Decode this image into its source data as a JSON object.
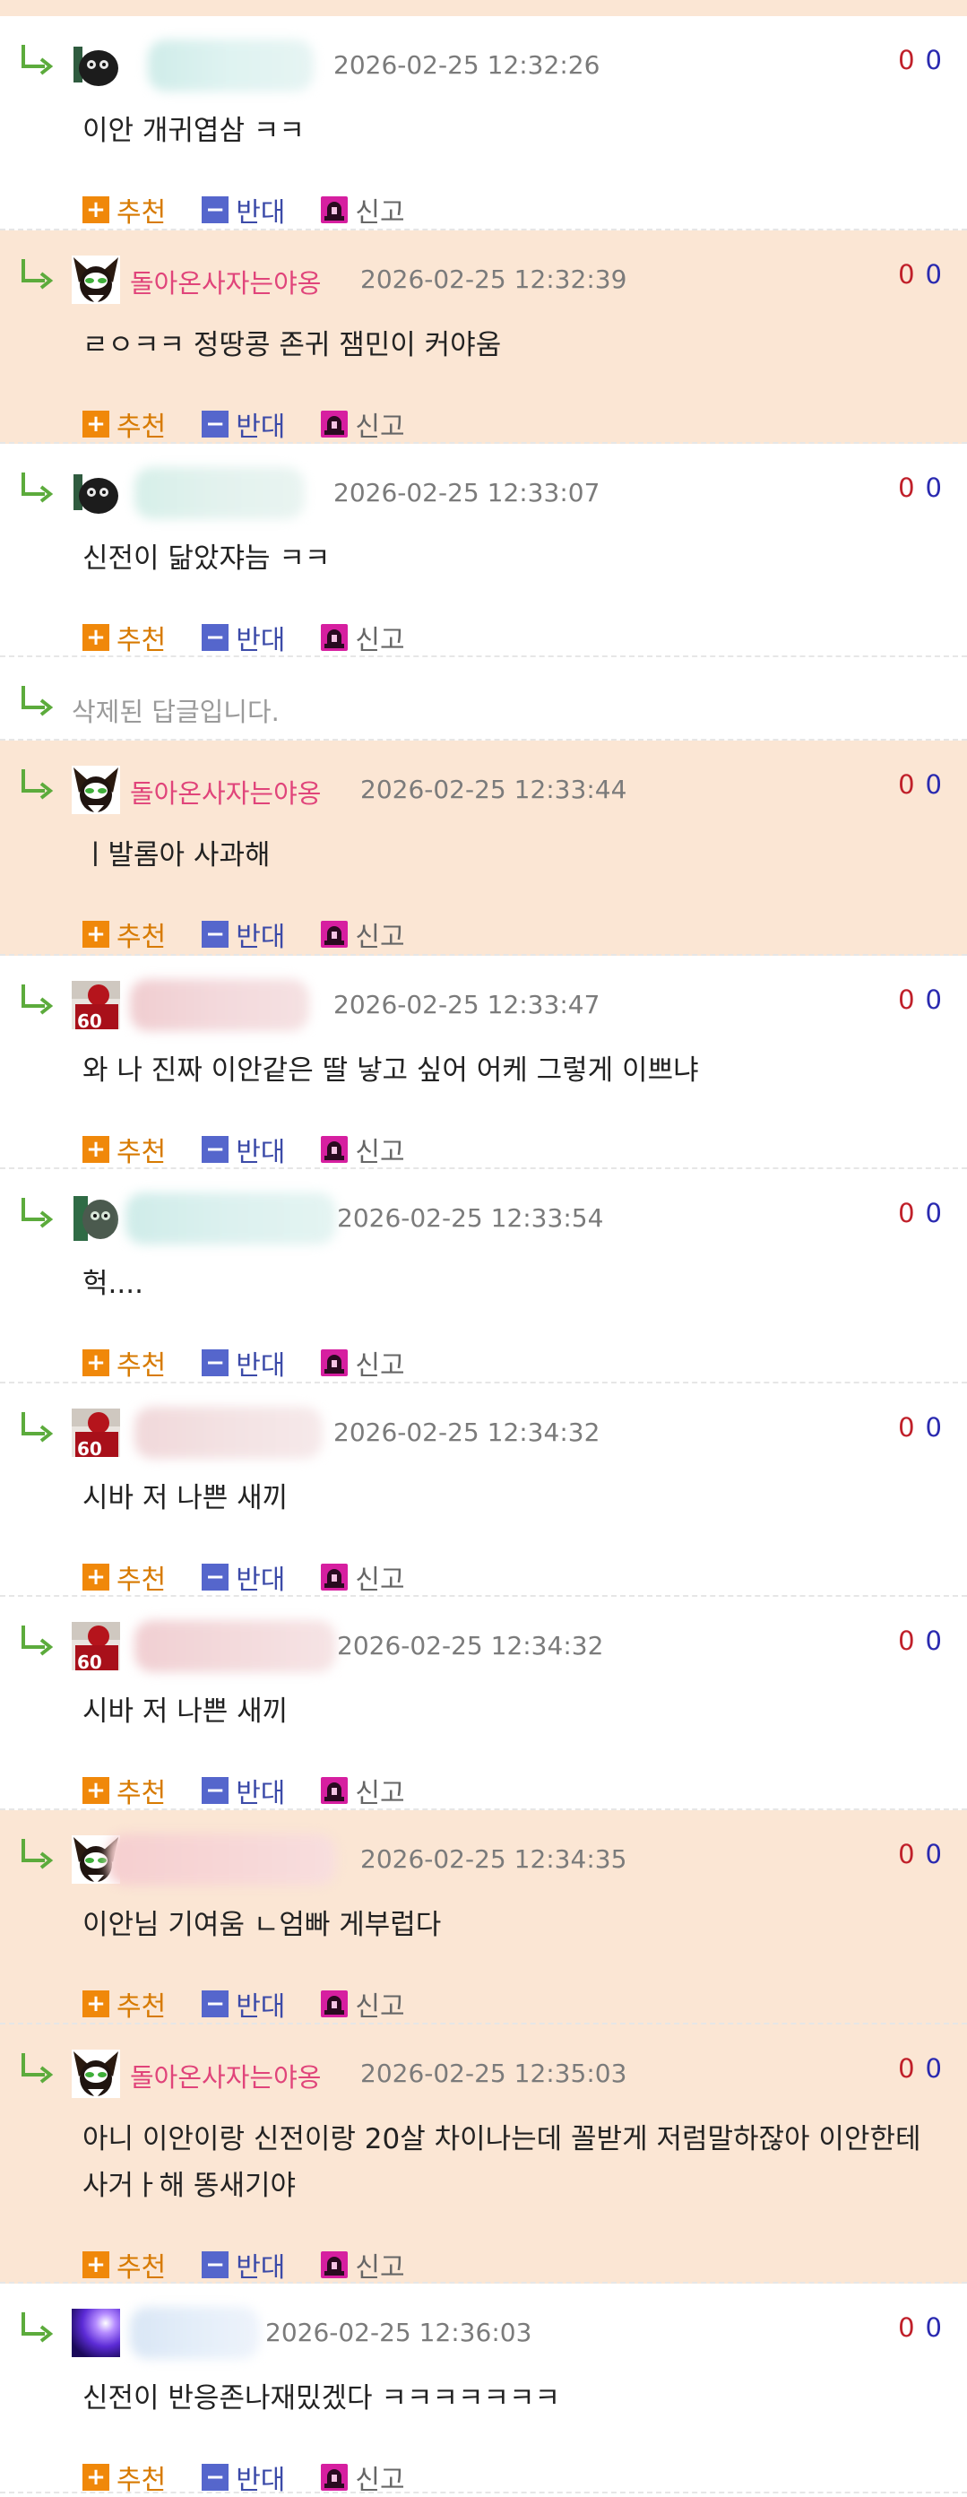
{
  "labels": {
    "recommend": "추천",
    "oppose": "반대",
    "report": "신고",
    "recommend_icon": "+",
    "oppose_icon": "−"
  },
  "colors": {
    "op_background": "#fbe6d4",
    "op_nick": "#e0447a",
    "recommend": "#f0880a",
    "oppose": "#5566cc",
    "report": "#d61fa0",
    "reply_arrow": "#5cab3c",
    "vote_up": "#c0202a",
    "vote_down": "#2a2ab0"
  },
  "comments": [
    {
      "type": "comment",
      "op": false,
      "nick": "",
      "avatar": "dark-creature-avatar",
      "timestamp": "2026-02-25 12:32:26",
      "up": "0",
      "down": "0",
      "content": [
        "이안 개귀엽삼 ㅋㅋ"
      ]
    },
    {
      "type": "comment",
      "op": true,
      "nick": "돌아온사자는야옹",
      "avatar": "lion-avatar",
      "timestamp": "2026-02-25 12:32:39",
      "up": "0",
      "down": "0",
      "content": [
        "ㄹㅇㅋㅋ 정땅콩 존귀 잼민이 커야움"
      ]
    },
    {
      "type": "comment",
      "op": false,
      "nick": "",
      "avatar": "dark-creature-avatar",
      "timestamp": "2026-02-25 12:33:07",
      "up": "0",
      "down": "0",
      "content": [
        "신전이 닮았쟈늠 ㅋㅋ"
      ]
    },
    {
      "type": "deleted",
      "text": "삭제된 답글입니다."
    },
    {
      "type": "comment",
      "op": true,
      "nick": "돌아온사자는야옹",
      "avatar": "lion-avatar",
      "timestamp": "2026-02-25 12:33:44",
      "up": "0",
      "down": "0",
      "content": [
        "ㅣ발롬아 사과해"
      ]
    },
    {
      "type": "comment",
      "op": false,
      "nick": "",
      "avatar": "football-player-avatar",
      "timestamp": "2026-02-25 12:33:47",
      "up": "0",
      "down": "0",
      "content": [
        "와 나 진짜 이안같은 딸 낳고 싶어 어케 그렇게 이쁘냐"
      ]
    },
    {
      "type": "comment",
      "op": false,
      "nick": "",
      "avatar": "green-creature-avatar",
      "timestamp": "2026-02-25 12:33:54",
      "up": "0",
      "down": "0",
      "content": [
        "헉...."
      ]
    },
    {
      "type": "comment",
      "op": false,
      "nick": "",
      "avatar": "football-player-avatar",
      "timestamp": "2026-02-25 12:34:32",
      "up": "0",
      "down": "0",
      "content": [
        "시바 저 나쁜 새끼"
      ]
    },
    {
      "type": "comment",
      "op": false,
      "nick": "",
      "avatar": "football-player-avatar",
      "timestamp": "2026-02-25 12:34:32",
      "up": "0",
      "down": "0",
      "content": [
        "시바 저 나쁜 새끼"
      ]
    },
    {
      "type": "comment",
      "op": true,
      "nick": "",
      "avatar": "lion-avatar",
      "timestamp": "2026-02-25 12:34:35",
      "up": "0",
      "down": "0",
      "content": [
        "이안님 기여움 ㄴ엄빠 게부럽다"
      ]
    },
    {
      "type": "comment",
      "op": true,
      "nick": "돌아온사자는야옹",
      "avatar": "lion-avatar",
      "timestamp": "2026-02-25 12:35:03",
      "up": "0",
      "down": "0",
      "content": [
        "아니 이안이랑 신전이랑 20살 차이나는데 꼴받게 저럼말하잖아 이안한테",
        "사거ㅏ해 똥새기야"
      ]
    },
    {
      "type": "comment",
      "op": false,
      "nick": "",
      "avatar": "purple-burst-avatar",
      "timestamp": "2026-02-25 12:36:03",
      "up": "0",
      "down": "0",
      "content": [
        "신전이 반응존나재밌겠다 ㅋㅋㅋㅋㅋㅋㅋ"
      ]
    }
  ]
}
